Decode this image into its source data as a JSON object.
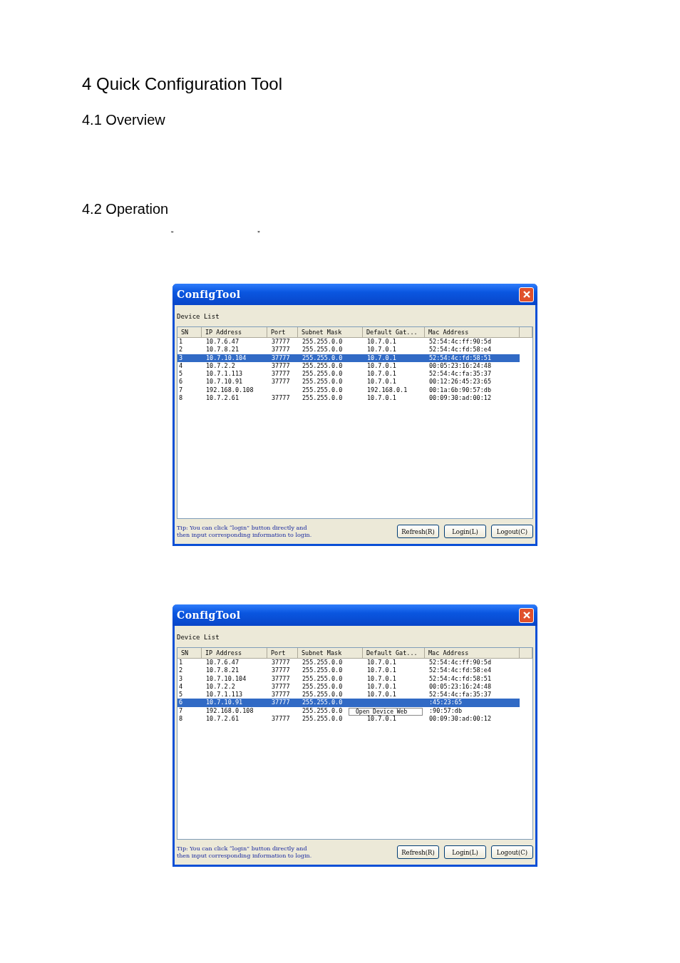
{
  "title": "4 Quick Configuration Tool",
  "sections": [
    {
      "heading": "4.1 Overview"
    },
    {
      "heading": "4.2 Operation"
    }
  ],
  "quote_marks": [
    "“",
    "”"
  ],
  "windows": [
    {
      "title": "ConfigTool",
      "section_label": "Device List",
      "columns": [
        "SN",
        "IP Address",
        "Port",
        "Subnet Mask",
        "Default Gat...",
        "Mac Address"
      ],
      "rows": [
        {
          "sn": "1",
          "ip_address": "10.7.6.47",
          "port": "37777",
          "subnet_mask": "255.255.0.0",
          "default_gateway": "10.7.0.1",
          "mac_address": "52:54:4c:ff:90:5d",
          "selected": false
        },
        {
          "sn": "2",
          "ip_address": "10.7.8.21",
          "port": "37777",
          "subnet_mask": "255.255.0.0",
          "default_gateway": "10.7.0.1",
          "mac_address": "52:54:4c:fd:58:e4",
          "selected": false
        },
        {
          "sn": "3",
          "ip_address": "10.7.10.104",
          "port": "37777",
          "subnet_mask": "255.255.0.0",
          "default_gateway": "10.7.0.1",
          "mac_address": "52:54:4c:fd:58:51",
          "selected": true
        },
        {
          "sn": "4",
          "ip_address": "10.7.2.2",
          "port": "37777",
          "subnet_mask": "255.255.0.0",
          "default_gateway": "10.7.0.1",
          "mac_address": "00:05:23:16:24:48",
          "selected": false
        },
        {
          "sn": "5",
          "ip_address": "10.7.1.113",
          "port": "37777",
          "subnet_mask": "255.255.0.0",
          "default_gateway": "10.7.0.1",
          "mac_address": "52:54:4c:fa:35:37",
          "selected": false
        },
        {
          "sn": "6",
          "ip_address": "10.7.10.91",
          "port": "37777",
          "subnet_mask": "255.255.0.0",
          "default_gateway": "10.7.0.1",
          "mac_address": "00:12:26:45:23:65",
          "selected": false
        },
        {
          "sn": "7",
          "ip_address": "192.168.0.108",
          "subnet_mask": "255.255.0.0",
          "default_gateway": "192.168.0.1",
          "mac_address": "00:1a:6b:90:57:db",
          "selected": false
        },
        {
          "sn": "8",
          "ip_address": "10.7.2.61",
          "port": "37777",
          "subnet_mask": "255.255.0.0",
          "default_gateway": "10.7.0.1",
          "mac_address": "00:09:30:ad:00:12",
          "selected": false
        }
      ],
      "tip": [
        "Tip: You can click “login” button directly and",
        "then input corresponding information to login."
      ],
      "buttons": [
        "Refresh(R)",
        "Login(L)",
        "Logout(C)"
      ]
    },
    {
      "title": "ConfigTool",
      "section_label": "Device List",
      "columns": [
        "SN",
        "IP Address",
        "Port",
        "Subnet Mask",
        "Default Gat...",
        "Mac Address"
      ],
      "rows": [
        {
          "sn": "1",
          "ip_address": "10.7.6.47",
          "port": "37777",
          "subnet_mask": "255.255.0.0",
          "default_gateway": "10.7.0.1",
          "mac_address": "52:54:4c:ff:90:5d",
          "selected": false
        },
        {
          "sn": "2",
          "ip_address": "10.7.8.21",
          "port": "37777",
          "subnet_mask": "255.255.0.0",
          "default_gateway": "10.7.0.1",
          "mac_address": "52:54:4c:fd:58:e4",
          "selected": false
        },
        {
          "sn": "3",
          "ip_address": "10.7.10.104",
          "port": "37777",
          "subnet_mask": "255.255.0.0",
          "default_gateway": "10.7.0.1",
          "mac_address": "52:54:4c:fd:58:51",
          "selected": false
        },
        {
          "sn": "4",
          "ip_address": "10.7.2.2",
          "port": "37777",
          "subnet_mask": "255.255.0.0",
          "default_gateway": "10.7.0.1",
          "mac_address": "00:05:23:16:24:48",
          "selected": false
        },
        {
          "sn": "5",
          "ip_address": "10.7.1.113",
          "port": "37777",
          "subnet_mask": "255.255.0.0",
          "default_gateway": "10.7.0.1",
          "mac_address": "52:54:4c:fa:35:37",
          "selected": false
        },
        {
          "sn": "6",
          "ip_address": "10.7.10.91",
          "port": "37777",
          "subnet_mask": "255.255.0.0",
          "mac_address": ":45:23:65",
          "selected": true
        },
        {
          "sn": "7",
          "ip_address": "192.168.0.108",
          "subnet_mask": "255.255.0.0",
          "mac_address": ":90:57:db",
          "selected": false
        },
        {
          "sn": "8",
          "ip_address": "10.7.2.61",
          "port": "37777",
          "subnet_mask": "255.255.0.0",
          "default_gateway": "10.7.0.1",
          "mac_address": "00:09:30:ad:00:12",
          "selected": false
        }
      ],
      "context_menu": {
        "items": [
          "Open Device Web"
        ]
      },
      "tip": [
        "Tip: You can click “login” button directly and",
        "then input corresponding information to login."
      ],
      "buttons": [
        "Refresh(R)",
        "Login(L)",
        "Logout(C)"
      ]
    }
  ]
}
